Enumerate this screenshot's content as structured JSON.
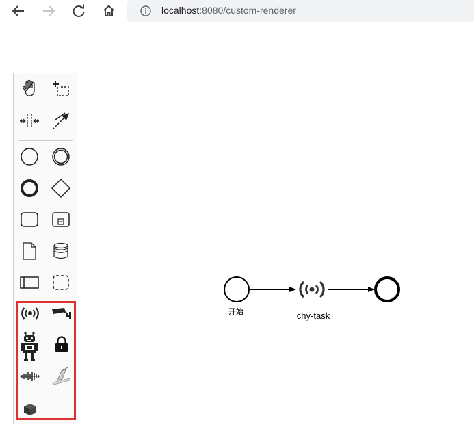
{
  "browser": {
    "url_host": "localhost",
    "url_rest": ":8080/custom-renderer",
    "icons": [
      "back-icon",
      "forward-icon",
      "reload-icon",
      "home-icon",
      "info-icon"
    ]
  },
  "palette": {
    "tools": [
      {
        "name": "hand-tool",
        "icon": "hand-icon"
      },
      {
        "name": "lasso-tool",
        "icon": "lasso-icon"
      },
      {
        "name": "space-tool",
        "icon": "space-icon"
      },
      {
        "name": "global-connect-tool",
        "icon": "connect-icon"
      },
      {
        "name": "create-start-event",
        "icon": "start-event-icon"
      },
      {
        "name": "create-intermediate-event",
        "icon": "intermediate-event-icon"
      },
      {
        "name": "create-end-event",
        "icon": "end-event-icon"
      },
      {
        "name": "create-gateway",
        "icon": "gateway-icon"
      },
      {
        "name": "create-task",
        "icon": "task-icon"
      },
      {
        "name": "create-subprocess",
        "icon": "subprocess-icon"
      },
      {
        "name": "create-data-object",
        "icon": "data-object-icon"
      },
      {
        "name": "create-data-store",
        "icon": "data-store-icon"
      },
      {
        "name": "create-pool",
        "icon": "pool-icon"
      },
      {
        "name": "create-group",
        "icon": "group-icon"
      }
    ],
    "custom_tools": [
      {
        "name": "custom-signal-task",
        "icon": "signal-icon"
      },
      {
        "name": "custom-camera-task",
        "icon": "camera-icon"
      },
      {
        "name": "custom-robot-task",
        "icon": "robot-icon"
      },
      {
        "name": "custom-lock-task",
        "icon": "lock-icon"
      },
      {
        "name": "custom-sound-task",
        "icon": "soundwave-icon"
      },
      {
        "name": "custom-scanner-task",
        "icon": "scanner-icon"
      },
      {
        "name": "custom-box-task",
        "icon": "box-icon"
      }
    ],
    "custom_border_color": "#e03131"
  },
  "diagram": {
    "start_label": "开始",
    "task_label": "chy-task"
  }
}
